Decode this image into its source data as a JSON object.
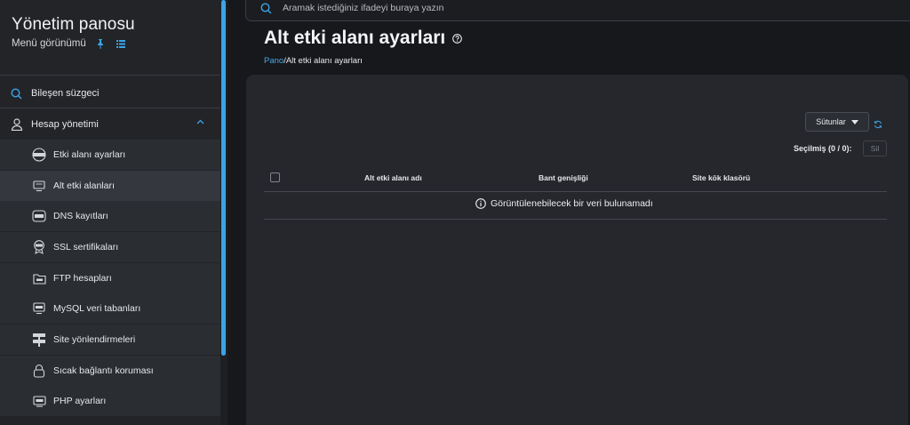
{
  "sidebar": {
    "title": "Yönetim panosu",
    "subtitle": "Menü görünümü",
    "filter_label": "Bileşen süzgeci",
    "group_label": "Hesap yönetimi",
    "items": [
      {
        "label": "Etki alanı ayarları",
        "icon": "globe-www-icon"
      },
      {
        "label": "Alt etki alanları",
        "icon": "monitor-icon"
      },
      {
        "label": "DNS kayıtları",
        "icon": "dns-icon"
      },
      {
        "label": "SSL sertifikaları",
        "icon": "ssl-badge-icon"
      },
      {
        "label": "FTP hesapları",
        "icon": "ftp-folder-icon"
      },
      {
        "label": "MySQL veri tabanları",
        "icon": "database-icon"
      },
      {
        "label": "Site yönlendirmeleri",
        "icon": "signpost-icon"
      },
      {
        "label": "Sıcak bağlantı koruması",
        "icon": "lock-icon"
      },
      {
        "label": "PHP ayarları",
        "icon": "php-icon"
      }
    ],
    "active_item": "Alt etki alanları"
  },
  "search": {
    "placeholder": "Aramak istediğiniz ifadeyi buraya yazın"
  },
  "page": {
    "title": "Alt etki alanı ayarları",
    "breadcrumb_home": "Pano",
    "breadcrumb_sep": "/",
    "breadcrumb_current": "Alt etki alanı ayarları"
  },
  "toolbar": {
    "columns_label": "Sütunlar",
    "selected_text": "Seçilmiş (0 / 0):",
    "delete_label": "Sil"
  },
  "table": {
    "headers": [
      "Alt etki alanı adı",
      "Bant genişliği",
      "Site kök klasörü"
    ],
    "empty_message": "Görüntülenebilecek bir veri bulunamadı"
  },
  "colors": {
    "accent": "#3aa4e8",
    "background": "#16181c",
    "sidebar": "#222428",
    "card": "#25272c"
  }
}
